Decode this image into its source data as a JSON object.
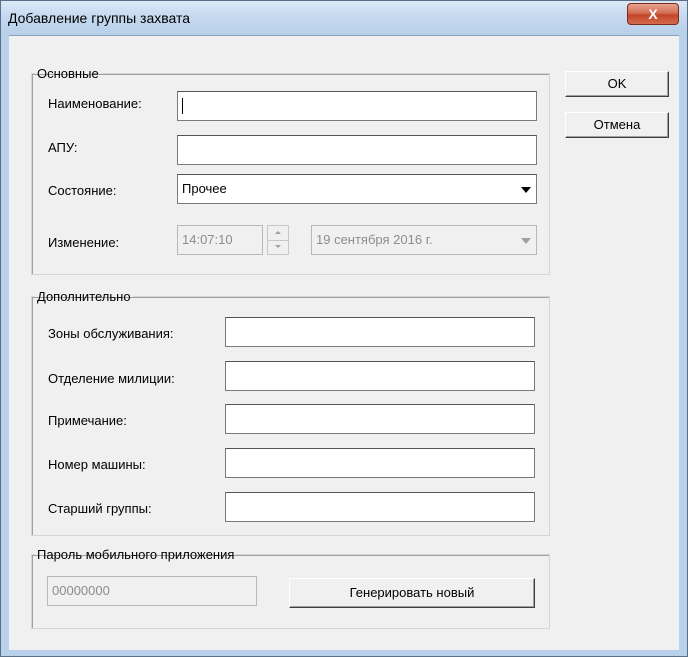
{
  "window": {
    "title": "Добавление группы захвата",
    "close_label": "X"
  },
  "main_group": {
    "legend": "Основные",
    "name_label": "Наименование:",
    "name_value": "",
    "apu_label": "АПУ:",
    "apu_value": "",
    "state_label": "Состояние:",
    "state_value": "Прочее",
    "change_label": "Изменение:",
    "change_time": "14:07:10",
    "change_date": "19 сентября 2016 г."
  },
  "extra_group": {
    "legend": "Дополнительно",
    "fields": [
      {
        "label": "Зоны обслуживания:",
        "value": ""
      },
      {
        "label": "Отделение милиции:",
        "value": ""
      },
      {
        "label": "Примечание:",
        "value": ""
      },
      {
        "label": "Номер машины:",
        "value": ""
      },
      {
        "label": "Старший группы:",
        "value": ""
      }
    ]
  },
  "password_group": {
    "legend": "Пароль мобильного приложения",
    "value": "00000000",
    "generate_label": "Генерировать новый"
  },
  "buttons": {
    "ok": "OK",
    "cancel": "Отмена"
  },
  "colors": {
    "title_bar": "#c4d8ef",
    "close_button": "#c2452a",
    "dialog_bg": "#f0f0f0"
  }
}
